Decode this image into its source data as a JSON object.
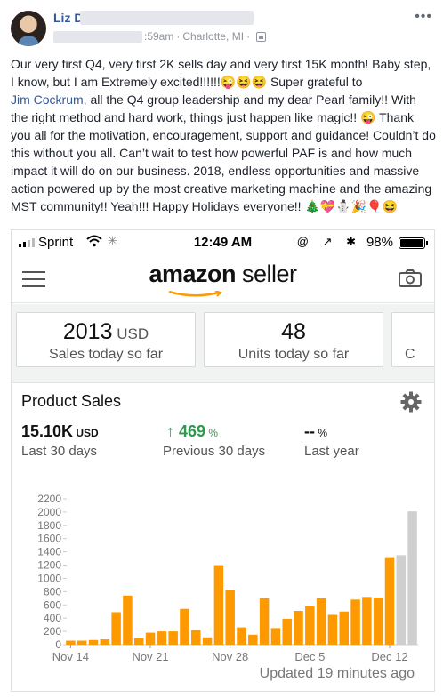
{
  "post": {
    "author_name": "Liz D",
    "timestamp": ":59am",
    "location": "Charlotte, MI",
    "more_icon": "more-options-icon",
    "text_before_mention": "Our very first Q4, very first 2K sells day and very first 15K month! Baby step, I know, but I am Extremely excited!!!!!!😜😆😆 Super grateful to",
    "mention": "Jim Cockrum",
    "text_after_mention": ", all the Q4 group leadership and my dear Pearl family!! With the right method and hard work, things just happen like magic!! 😜 Thank you all for the motivation, encouragement, support and guidance! Couldn’t do this without you all. Can’t wait to test how powerful PAF is and how much impact it will do on our business. 2018, endless opportunities and massive action powered up by the most creative marketing machine and the amazing MST community!! Yeah!!! Happy Holidays everyone!! 🎄💝⛄🎉🎈😆"
  },
  "phone": {
    "carrier": "Sprint",
    "time": "12:49 AM",
    "status_icons": "@ ↗ ✱",
    "battery": "98%"
  },
  "app": {
    "logo_brand": "amazon",
    "logo_suffix": " seller",
    "brand_color": "#ff9900"
  },
  "stats": {
    "sales_value": "2013",
    "sales_unit": " USD",
    "sales_label": "Sales today so far",
    "units_value": "48",
    "units_label": "Units today so far",
    "third_label": "C"
  },
  "product_sales": {
    "title": "Product Sales",
    "current_value": "15.10K",
    "current_unit": " USD",
    "current_label": "Last 30 days",
    "previous_arrow": "↑",
    "previous_value": "469",
    "previous_unit": " %",
    "previous_label": "Previous 30 days",
    "lastyear_value": "--",
    "lastyear_unit": " %",
    "lastyear_label": "Last year",
    "updated": "Updated 19 minutes ago"
  },
  "chart_data": {
    "type": "bar",
    "ylim": [
      0,
      2200
    ],
    "yticks": [
      0,
      200,
      400,
      600,
      800,
      1000,
      1200,
      1400,
      1600,
      1800,
      2000,
      2200
    ],
    "xtick_labels": [
      "Nov 14",
      "Nov 21",
      "Nov 28",
      "Dec 5",
      "Dec 12"
    ],
    "xtick_indices": [
      0,
      7,
      14,
      21,
      28
    ],
    "values": [
      60,
      60,
      70,
      80,
      490,
      740,
      100,
      180,
      200,
      200,
      540,
      220,
      110,
      1200,
      830,
      260,
      150,
      700,
      250,
      390,
      510,
      580,
      700,
      450,
      500,
      680,
      720,
      710,
      1320,
      1350,
      2010
    ],
    "highlight_color": "#ff9900",
    "muted_color": "#cfcfcf",
    "muted_from_index": 29,
    "grid": false
  }
}
